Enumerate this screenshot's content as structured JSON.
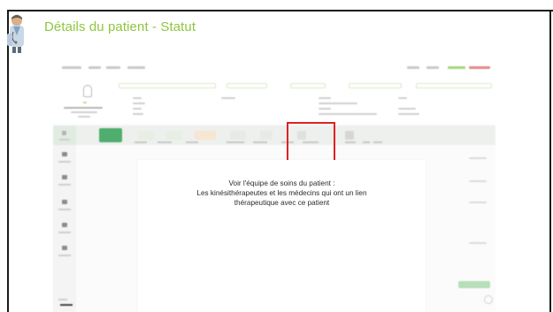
{
  "slide": {
    "title": "Détails du patient - Statut",
    "title_color": "#8fc63f",
    "icon": "doctor-icon"
  },
  "callout": {
    "line1": "Voir l'équipe de soins du patient :",
    "line2": "Les kinésithérapeutes et les médecins qui ont un lien",
    "line3": "thérapeutique avec ce patient"
  },
  "highlight": {
    "color": "#e02020",
    "target": "patient-status-tab"
  },
  "app": {
    "accent_green": "#4fae6d"
  }
}
